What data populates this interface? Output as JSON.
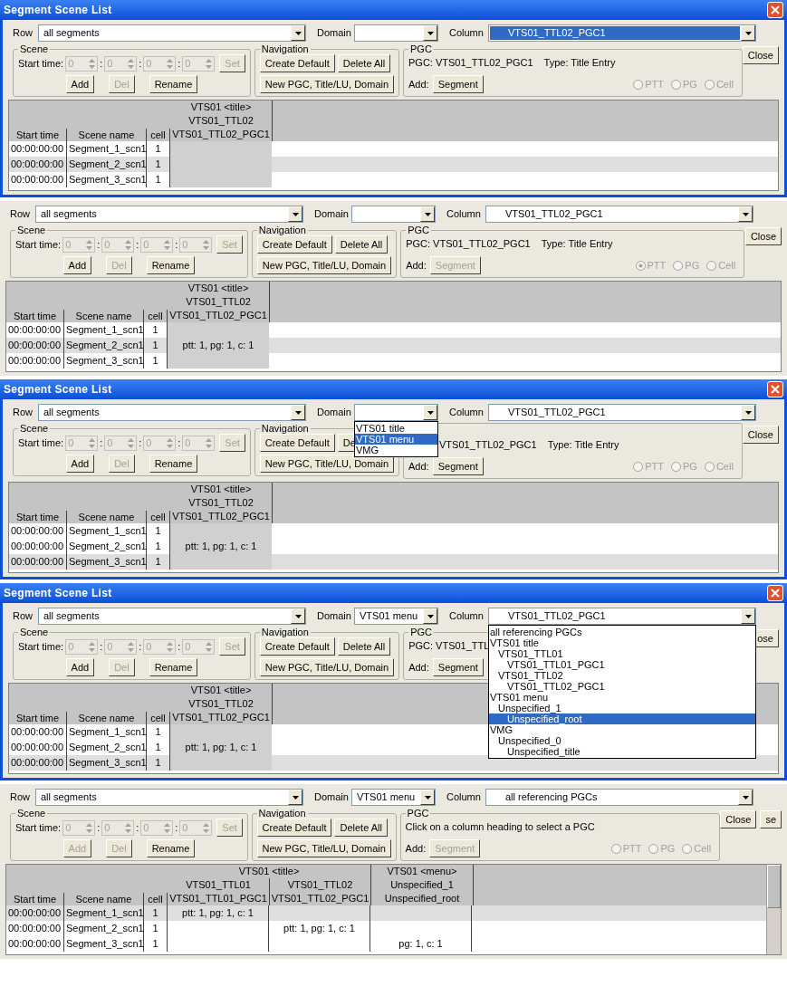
{
  "panels": [
    {
      "title": "Segment Scene List",
      "row": {
        "label": "Row",
        "value": "all segments"
      },
      "domain": {
        "label": "Domain"
      },
      "column": {
        "label": "Column",
        "value": "VTS01_TTL02_PGC1",
        "highlighted": true
      },
      "scene": {
        "legend": "Scene",
        "start_label": "Start time:",
        "parts": [
          {
            "kind": "spin",
            "value": "0"
          },
          {
            "kind": "sep",
            "text": ":"
          },
          {
            "kind": "spin",
            "value": "0"
          },
          {
            "kind": "sep",
            "text": ":"
          },
          {
            "kind": "spin",
            "value": "0"
          },
          {
            "kind": "sep",
            "text": ":"
          },
          {
            "kind": "spin",
            "value": "0"
          }
        ],
        "set": {
          "label": "Set",
          "disabled": true
        },
        "buttons": [
          {
            "label": "Add",
            "disabled": false
          },
          {
            "label": "Del",
            "disabled": true
          },
          {
            "label": "Rename",
            "disabled": false
          }
        ]
      },
      "navigation": {
        "legend": "Navigation",
        "rows": [
          [
            {
              "label": "Create Default",
              "disabled": false
            },
            {
              "label": "Delete All",
              "disabled": false
            }
          ],
          [
            {
              "label": "New PGC, Title/LU, Domain",
              "disabled": false
            }
          ]
        ]
      },
      "pgc": {
        "legend": "PGC",
        "info": [
          "PGC: VTS01_TTL02_PGC1",
          "Type: Title Entry"
        ],
        "add_label": "Add:",
        "segment": {
          "label": "Segment",
          "disabled": false
        },
        "radios": [
          {
            "label": "PTT",
            "selected": false,
            "disabled": true
          },
          {
            "label": "PG",
            "selected": false,
            "disabled": true
          },
          {
            "label": "Cell",
            "selected": false,
            "disabled": true
          }
        ]
      },
      "close": "Close",
      "table": {
        "columns": [
          "Start time",
          "Scene name",
          "cell"
        ],
        "groups": [
          {
            "domain": "VTS01 <title>",
            "columns": [
              {
                "title": "VTS01_TTL02",
                "pgc": "VTS01_TTL02_PGC1",
                "selected": true
              }
            ]
          }
        ],
        "rows": [
          {
            "start": "00:00:00:00",
            "name": "Segment_1_scn1",
            "cell": "1",
            "selected": false,
            "cells": [
              {
                "kind": "empty"
              }
            ]
          },
          {
            "start": "00:00:00:00",
            "name": "Segment_2_scn1",
            "cell": "1",
            "selected": true,
            "cells": [
              {
                "kind": "empty"
              }
            ]
          },
          {
            "start": "00:00:00:00",
            "name": "Segment_3_scn1",
            "cell": "1",
            "selected": false,
            "cells": [
              {
                "kind": "empty"
              }
            ]
          }
        ]
      }
    },
    {
      "row": {
        "label": "Row",
        "value": "all segments"
      },
      "domain": {
        "label": "Domain"
      },
      "column": {
        "label": "Column",
        "value": "VTS01_TTL02_PGC1",
        "highlighted": false
      },
      "scene": {
        "legend": "Scene",
        "start_label": "Start time:",
        "parts": [
          {
            "kind": "spin",
            "value": "0"
          },
          {
            "kind": "sep",
            "text": ":"
          },
          {
            "kind": "spin",
            "value": "0"
          },
          {
            "kind": "sep",
            "text": ":"
          },
          {
            "kind": "spin",
            "value": "0"
          },
          {
            "kind": "sep",
            "text": ":"
          },
          {
            "kind": "spin",
            "value": "0"
          }
        ],
        "set": {
          "label": "Set",
          "disabled": true
        },
        "buttons": [
          {
            "label": "Add",
            "disabled": false
          },
          {
            "label": "Del",
            "disabled": true
          },
          {
            "label": "Rename",
            "disabled": false
          }
        ]
      },
      "navigation": {
        "legend": "Navigation",
        "rows": [
          [
            {
              "label": "Create Default",
              "disabled": false
            },
            {
              "label": "Delete All",
              "disabled": false
            }
          ],
          [
            {
              "label": "New PGC, Title/LU, Domain",
              "disabled": false
            }
          ]
        ]
      },
      "pgc": {
        "legend": "PGC",
        "info": [
          "PGC: VTS01_TTL02_PGC1",
          "Type: Title Entry"
        ],
        "add_label": "Add:",
        "segment": {
          "label": "Segment",
          "disabled": true
        },
        "radios": [
          {
            "label": "PTT",
            "selected": true,
            "disabled": true
          },
          {
            "label": "PG",
            "selected": false,
            "disabled": true
          },
          {
            "label": "Cell",
            "selected": false,
            "disabled": true
          }
        ]
      },
      "close": "Close",
      "table": {
        "columns": [
          "Start time",
          "Scene name",
          "cell"
        ],
        "groups": [
          {
            "domain": "VTS01 <title>",
            "columns": [
              {
                "title": "VTS01_TTL02",
                "pgc": "VTS01_TTL02_PGC1",
                "selected": true
              }
            ]
          }
        ],
        "rows": [
          {
            "start": "00:00:00:00",
            "name": "Segment_1_scn1",
            "cell": "1",
            "selected": false,
            "cells": [
              {
                "kind": "empty"
              }
            ]
          },
          {
            "start": "00:00:00:00",
            "name": "Segment_2_scn1",
            "cell": "1",
            "selected": true,
            "cells": [
              {
                "kind": "value",
                "text": "ptt: 1, pg: 1, c: 1"
              }
            ]
          },
          {
            "start": "00:00:00:00",
            "name": "Segment_3_scn1",
            "cell": "1",
            "selected": false,
            "cells": [
              {
                "kind": "empty"
              }
            ]
          }
        ]
      }
    },
    {
      "title": "Segment Scene List",
      "row": {
        "label": "Row",
        "value": "all segments"
      },
      "domain": {
        "label": "Domain",
        "list": [
          {
            "label": "VTS01 title",
            "selected": false
          },
          {
            "label": "VTS01 menu",
            "selected": true
          },
          {
            "label": "VMG",
            "selected": false
          }
        ]
      },
      "column": {
        "label": "Column",
        "value": "VTS01_TTL02_PGC1",
        "highlighted": false
      },
      "scene": {
        "legend": "Scene",
        "start_label": "Start time:",
        "parts": [
          {
            "kind": "spin",
            "value": "0"
          },
          {
            "kind": "sep",
            "text": ":"
          },
          {
            "kind": "spin",
            "value": "0"
          },
          {
            "kind": "sep",
            "text": ":"
          },
          {
            "kind": "spin",
            "value": "0"
          },
          {
            "kind": "sep",
            "text": ":"
          },
          {
            "kind": "spin",
            "value": "0"
          }
        ],
        "set": {
          "label": "Set",
          "disabled": true
        },
        "buttons": [
          {
            "label": "Add",
            "disabled": false
          },
          {
            "label": "Del",
            "disabled": true
          },
          {
            "label": "Rename",
            "disabled": false
          }
        ]
      },
      "navigation": {
        "legend": "Navigation",
        "rows": [
          [
            {
              "label": "Create Default",
              "disabled": false
            },
            {
              "label": "De",
              "disabled": false
            }
          ],
          [
            {
              "label": "New PGC, Title/LU, Domain",
              "disabled": false
            }
          ]
        ]
      },
      "pgc": {
        "info": [
          "VTS01_TTL02_PGC1",
          "Type: Title Entry"
        ],
        "add_label": "Add:",
        "segment": {
          "label": "Segment",
          "disabled": false
        },
        "radios": [
          {
            "label": "PTT",
            "selected": false,
            "disabled": true
          },
          {
            "label": "PG",
            "selected": false,
            "disabled": true
          },
          {
            "label": "Cell",
            "selected": false,
            "disabled": true
          }
        ]
      },
      "close": "Close",
      "table": {
        "columns": [
          "Start time",
          "Scene name",
          "cell"
        ],
        "groups": [
          {
            "domain": "VTS01 <title>",
            "columns": [
              {
                "title": "VTS01_TTL02",
                "pgc": "VTS01_TTL02_PGC1",
                "selected": true
              }
            ]
          }
        ],
        "rows": [
          {
            "start": "00:00:00:00",
            "name": "Segment_1_scn1",
            "cell": "1",
            "selected": false,
            "cells": [
              {
                "kind": "empty"
              }
            ]
          },
          {
            "start": "00:00:00:00",
            "name": "Segment_2_scn1",
            "cell": "1",
            "selected": false,
            "cells": [
              {
                "kind": "value",
                "text": "ptt: 1, pg: 1, c: 1"
              }
            ]
          },
          {
            "start": "00:00:00:00",
            "name": "Segment_3_scn1",
            "cell": "1",
            "selected": true,
            "cells": [
              {
                "kind": "empty"
              }
            ]
          }
        ]
      }
    },
    {
      "title": "Segment Scene List",
      "row": {
        "label": "Row",
        "value": "all segments"
      },
      "domain": {
        "label": "Domain",
        "value": "VTS01 menu"
      },
      "column": {
        "label": "Column",
        "value": "VTS01_TTL02_PGC1",
        "highlighted": false,
        "list": [
          {
            "label": "all referencing PGCs",
            "selected": false
          },
          {
            "label": "VTS01 title",
            "selected": false,
            "children": [
              {
                "label": "VTS01_TTL01",
                "selected": false,
                "children": [
                  {
                    "label": "VTS01_TTL01_PGC1",
                    "selected": false
                  }
                ]
              },
              {
                "label": "VTS01_TTL02",
                "selected": false,
                "children": [
                  {
                    "label": "VTS01_TTL02_PGC1",
                    "selected": false
                  }
                ]
              }
            ]
          },
          {
            "label": "VTS01 menu",
            "selected": false,
            "children": [
              {
                "label": "Unspecified_1",
                "selected": false,
                "children": [
                  {
                    "label": "Unspecified_root",
                    "selected": true
                  }
                ]
              }
            ]
          },
          {
            "label": "VMG",
            "selected": false,
            "children": [
              {
                "label": "Unspecified_0",
                "selected": false,
                "children": [
                  {
                    "label": "Unspecified_title",
                    "selected": false
                  }
                ]
              }
            ]
          }
        ]
      },
      "scene": {
        "legend": "Scene",
        "start_label": "Start time:",
        "parts": [
          {
            "kind": "spin",
            "value": "0"
          },
          {
            "kind": "sep",
            "text": ":"
          },
          {
            "kind": "spin",
            "value": "0"
          },
          {
            "kind": "sep",
            "text": ":"
          },
          {
            "kind": "spin",
            "value": "0"
          },
          {
            "kind": "sep",
            "text": ":"
          },
          {
            "kind": "spin",
            "value": "0"
          }
        ],
        "set": {
          "label": "Set",
          "disabled": true
        },
        "buttons": [
          {
            "label": "Add",
            "disabled": false
          },
          {
            "label": "Del",
            "disabled": true
          },
          {
            "label": "Rename",
            "disabled": false
          }
        ]
      },
      "navigation": {
        "legend": "Navigation",
        "rows": [
          [
            {
              "label": "Create Default",
              "disabled": false
            },
            {
              "label": "Delete All",
              "disabled": false
            }
          ],
          [
            {
              "label": "New PGC, Title/LU, Domain",
              "disabled": false
            }
          ]
        ]
      },
      "pgc": {
        "legend": "PGC",
        "info": [
          "PGC: VTS01_TTL"
        ],
        "add_label": "Add:",
        "segment": {
          "label": "Segment",
          "disabled": false
        }
      },
      "close": "ose",
      "table": {
        "columns": [
          "Start time",
          "Scene name",
          "cell"
        ],
        "groups": [
          {
            "domain": "VTS01 <title>",
            "columns": [
              {
                "title": "VTS01_TTL02",
                "pgc": "VTS01_TTL02_PGC1",
                "selected": true
              }
            ]
          }
        ],
        "rows": [
          {
            "start": "00:00:00:00",
            "name": "Segment_1_scn1",
            "cell": "1",
            "selected": false,
            "cells": [
              {
                "kind": "empty"
              }
            ]
          },
          {
            "start": "00:00:00:00",
            "name": "Segment_2_scn1",
            "cell": "1",
            "selected": false,
            "cells": [
              {
                "kind": "value",
                "text": "ptt: 1, pg: 1, c: 1"
              }
            ]
          },
          {
            "start": "00:00:00:00",
            "name": "Segment_3_scn1",
            "cell": "1",
            "selected": true,
            "cells": [
              {
                "kind": "empty"
              }
            ]
          }
        ]
      }
    },
    {
      "row": {
        "label": "Row",
        "value": "all segments"
      },
      "domain": {
        "label": "Domain",
        "value": "VTS01 menu"
      },
      "column": {
        "label": "Column",
        "value": "all referencing PGCs",
        "highlighted": false
      },
      "scene": {
        "legend": "Scene",
        "start_label": "Start time:",
        "parts": [
          {
            "kind": "spin",
            "value": "0"
          },
          {
            "kind": "sep",
            "text": ":"
          },
          {
            "kind": "spin",
            "value": "0"
          },
          {
            "kind": "sep",
            "text": ":"
          },
          {
            "kind": "spin",
            "value": "0"
          },
          {
            "kind": "sep",
            "text": ":"
          },
          {
            "kind": "spin",
            "value": "0"
          }
        ],
        "set": {
          "label": "Set",
          "disabled": true
        },
        "buttons": [
          {
            "label": "Add",
            "disabled": true
          },
          {
            "label": "Del",
            "disabled": true
          },
          {
            "label": "Rename",
            "disabled": false
          }
        ]
      },
      "navigation": {
        "legend": "Navigation",
        "rows": [
          [
            {
              "label": "Create Default",
              "disabled": false
            },
            {
              "label": "Delete All",
              "disabled": false
            }
          ],
          [
            {
              "label": "New PGC, Title/LU, Domain",
              "disabled": false
            }
          ]
        ]
      },
      "pgc": {
        "legend": "PGC",
        "info": [
          "Click on a column heading to select a PGC"
        ],
        "add_label": "Add:",
        "segment": {
          "label": "Segment",
          "disabled": true
        },
        "radios": [
          {
            "label": "PTT",
            "selected": false,
            "disabled": true
          },
          {
            "label": "PG",
            "selected": false,
            "disabled": true
          },
          {
            "label": "Cell",
            "selected": false,
            "disabled": true
          }
        ]
      },
      "close": "Close",
      "extra_button": "se",
      "table": {
        "scrollbar": true,
        "columns": [
          "Start time",
          "Scene name",
          "cell"
        ],
        "groups": [
          {
            "domain": "VTS01 <title>",
            "columns": [
              {
                "title": "VTS01_TTL01",
                "pgc": "VTS01_TTL01_PGC1",
                "selected": false
              },
              {
                "title": "VTS01_TTL02",
                "pgc": "VTS01_TTL02_PGC1",
                "selected": false
              }
            ]
          },
          {
            "domain": "VTS01 <menu>",
            "columns": [
              {
                "title": "Unspecified_1",
                "pgc": "Unspecified_root",
                "selected": false
              }
            ]
          }
        ],
        "rows": [
          {
            "start": "00:00:00:00",
            "name": "Segment_1_scn1",
            "cell": "1",
            "selected": true,
            "cells": [
              {
                "kind": "value",
                "text": "ptt: 1, pg: 1, c: 1"
              },
              {
                "kind": "empty"
              },
              {
                "kind": "empty"
              }
            ]
          },
          {
            "start": "00:00:00:00",
            "name": "Segment_2_scn1",
            "cell": "1",
            "selected": false,
            "cells": [
              {
                "kind": "empty"
              },
              {
                "kind": "value",
                "text": "ptt: 1, pg: 1, c: 1"
              },
              {
                "kind": "empty"
              }
            ]
          },
          {
            "start": "00:00:00:00",
            "name": "Segment_3_scn1",
            "cell": "1",
            "selected": false,
            "cells": [
              {
                "kind": "empty"
              },
              {
                "kind": "empty"
              },
              {
                "kind": "value",
                "text": "pg: 1, c: 1"
              }
            ]
          }
        ]
      }
    }
  ]
}
